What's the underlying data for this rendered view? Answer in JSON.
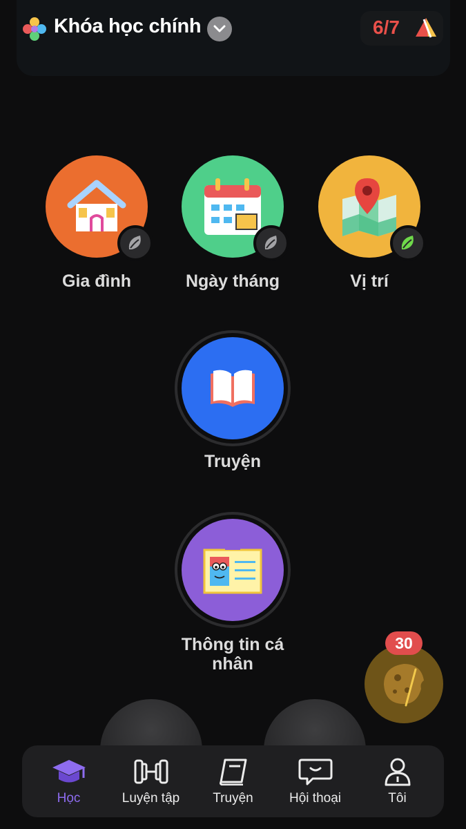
{
  "header": {
    "course_title": "Khóa học chính",
    "progress": "6/7"
  },
  "lessons": [
    {
      "label": "Gia đình",
      "color": "#eb6e2f",
      "badge_state": "locked",
      "icon": "house-icon"
    },
    {
      "label": "Ngày tháng",
      "color": "#4fcf8a",
      "badge_state": "locked",
      "icon": "calendar-icon"
    },
    {
      "label": "Vị trí",
      "color": "#f1b43d",
      "badge_state": "completed",
      "icon": "map-pin-icon"
    },
    {
      "label": "Truyện",
      "color": "#2c6ef2",
      "badge_state": "none",
      "icon": "book-icon"
    },
    {
      "label": "Thông tin cá nhân",
      "label_line1": "Thông tin cá",
      "label_line2": "nhân",
      "color": "#8c5ed8",
      "badge_state": "none",
      "icon": "id-card-icon"
    }
  ],
  "reward": {
    "count": "30"
  },
  "nav": {
    "items": [
      {
        "label": "Học",
        "icon": "graduation-cap-icon",
        "active": true
      },
      {
        "label": "Luyện tập",
        "icon": "dumbbell-icon",
        "active": false
      },
      {
        "label": "Truyện",
        "icon": "book-icon",
        "active": false
      },
      {
        "label": "Hội thoại",
        "icon": "chat-bubble-icon",
        "active": false
      },
      {
        "label": "Tôi",
        "icon": "person-icon",
        "active": false
      }
    ]
  },
  "colors": {
    "accent": "#8e6cf0",
    "progress": "#e9504a",
    "badge_red": "#e14d4d"
  }
}
